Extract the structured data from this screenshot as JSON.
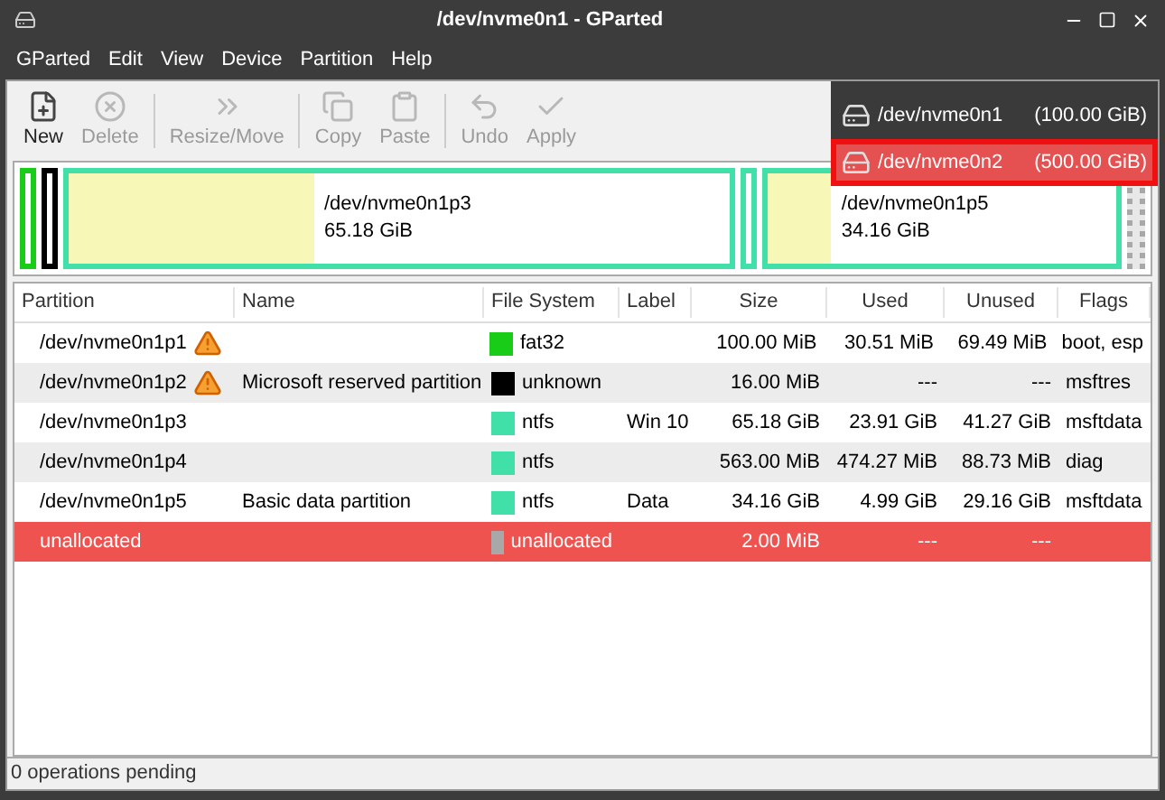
{
  "window": {
    "title": "/dev/nvme0n1 - GParted"
  },
  "menu": [
    "GParted",
    "Edit",
    "View",
    "Device",
    "Partition",
    "Help"
  ],
  "toolbar": [
    {
      "kind": "new",
      "label": "New",
      "disabled": false
    },
    {
      "kind": "delete",
      "label": "Delete",
      "disabled": true
    },
    {
      "kind": "resize",
      "label": "Resize/Move",
      "disabled": true
    },
    {
      "kind": "copy",
      "label": "Copy",
      "disabled": true
    },
    {
      "kind": "paste",
      "label": "Paste",
      "disabled": true
    },
    {
      "kind": "undo",
      "label": "Undo",
      "disabled": true
    },
    {
      "kind": "apply",
      "label": "Apply",
      "disabled": true
    }
  ],
  "devices": [
    {
      "name": "/dev/nvme0n1",
      "size": "(100.00 GiB)",
      "selected": false
    },
    {
      "name": "/dev/nvme0n2",
      "size": "(500.00 GiB)",
      "selected": true
    }
  ],
  "disk_map": [
    {
      "kind": "small",
      "color": "#18cc18"
    },
    {
      "kind": "small",
      "color": "#000000"
    },
    {
      "kind": "large",
      "color": "#40e0a8",
      "level": 0.37,
      "name": "/dev/nvme0n1p3",
      "size": "65.18 GiB"
    },
    {
      "kind": "small",
      "color": "#40e0a8"
    },
    {
      "kind": "medium",
      "color": "#40e0a8",
      "level": 0.18,
      "name": "/dev/nvme0n1p5",
      "size": "34.16 GiB"
    },
    {
      "kind": "unallocated",
      "color": "#a8a8a8"
    }
  ],
  "table": {
    "columns": [
      "Partition",
      "Name",
      "File System",
      "Label",
      "Size",
      "Used",
      "Unused",
      "Flags"
    ],
    "rows": [
      {
        "partition": "/dev/nvme0n1p1",
        "warning": true,
        "name": "",
        "color": "#18cc18",
        "fs": "fat32",
        "label": "",
        "size": "100.00 MiB",
        "used": "30.51 MiB",
        "unused": "69.49 MiB",
        "flags": "boot, esp",
        "selected": false
      },
      {
        "partition": "/dev/nvme0n1p2",
        "warning": true,
        "name": "Microsoft reserved partition",
        "color": "#000000",
        "fs": "unknown",
        "label": "",
        "size": "16.00 MiB",
        "used": "---",
        "unused": "---",
        "flags": "msftres",
        "selected": false
      },
      {
        "partition": "/dev/nvme0n1p3",
        "warning": false,
        "name": "",
        "color": "#40e0a8",
        "fs": "ntfs",
        "label": "Win 10",
        "size": "65.18 GiB",
        "used": "23.91 GiB",
        "unused": "41.27 GiB",
        "flags": "msftdata",
        "selected": false
      },
      {
        "partition": "/dev/nvme0n1p4",
        "warning": false,
        "name": "",
        "color": "#40e0a8",
        "fs": "ntfs",
        "label": "",
        "size": "563.00 MiB",
        "used": "474.27 MiB",
        "unused": "88.73 MiB",
        "flags": "diag",
        "selected": false
      },
      {
        "partition": "/dev/nvme0n1p5",
        "warning": false,
        "name": "Basic data partition",
        "color": "#40e0a8",
        "fs": "ntfs",
        "label": "Data",
        "size": "34.16 GiB",
        "used": "4.99 GiB",
        "unused": "29.16 GiB",
        "flags": "msftdata",
        "selected": false
      },
      {
        "partition": "unallocated",
        "warning": false,
        "name": "",
        "color": "#a8a8a8",
        "fs": "unallocated",
        "label": "",
        "size": "2.00 MiB",
        "used": "---",
        "unused": "---",
        "flags": "",
        "selected": true
      }
    ]
  },
  "status_bar": "0 operations pending"
}
